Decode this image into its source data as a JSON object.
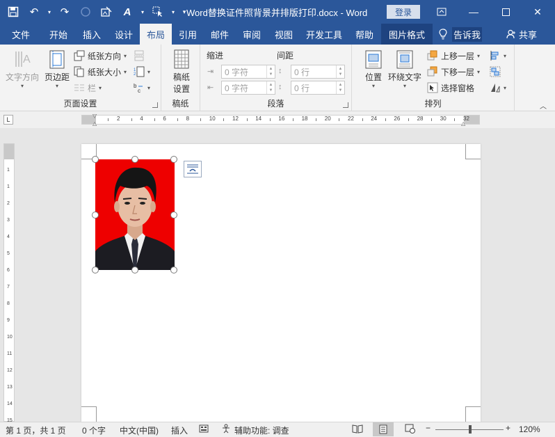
{
  "titlebar": {
    "title": "Word替换证件照背景并排版打印.docx  -  Word",
    "login": "登录"
  },
  "tabs": [
    {
      "label": "文件"
    },
    {
      "label": "开始"
    },
    {
      "label": "插入"
    },
    {
      "label": "设计"
    },
    {
      "label": "布局"
    },
    {
      "label": "引用"
    },
    {
      "label": "邮件"
    },
    {
      "label": "审阅"
    },
    {
      "label": "视图"
    },
    {
      "label": "开发工具"
    },
    {
      "label": "帮助"
    },
    {
      "label": "图片格式"
    }
  ],
  "tellme": "告诉我",
  "share": "共享",
  "ribbon": {
    "page_setup": {
      "label": "页面设置",
      "text_direction": "文字方向",
      "margins": "页边距",
      "orientation": "纸张方向",
      "size": "纸张大小",
      "columns": "栏"
    },
    "manuscript": {
      "label": "稿纸",
      "settings_line1": "稿纸",
      "settings_line2": "设置"
    },
    "paragraph": {
      "label": "段落",
      "indent": "缩进",
      "spacing": "间距",
      "indent_left": "0 字符",
      "indent_right": "0 字符",
      "spacing_before": "0 行",
      "spacing_after": "0 行"
    },
    "arrange": {
      "label": "排列",
      "position": "位置",
      "wrap_text": "环绕文字",
      "bring_forward": "上移一层",
      "send_backward": "下移一层",
      "selection_pane": "选择窗格"
    }
  },
  "ruler": {
    "ticks": [
      "2",
      "4",
      "6",
      "8",
      "10",
      "12",
      "14",
      "16",
      "18",
      "20",
      "22",
      "24",
      "26",
      "28",
      "30",
      "32"
    ],
    "vticks": [
      "1",
      "1",
      "2",
      "3",
      "4",
      "5",
      "6",
      "7",
      "8",
      "9",
      "10",
      "11",
      "12",
      "13",
      "14",
      "15",
      "5"
    ]
  },
  "statusbar": {
    "page": "第 1 页，共 1 页",
    "words": "0 个字",
    "language": "中文(中国)",
    "mode": "插入",
    "accessibility": "辅助功能: 调查",
    "zoom": "120%"
  }
}
